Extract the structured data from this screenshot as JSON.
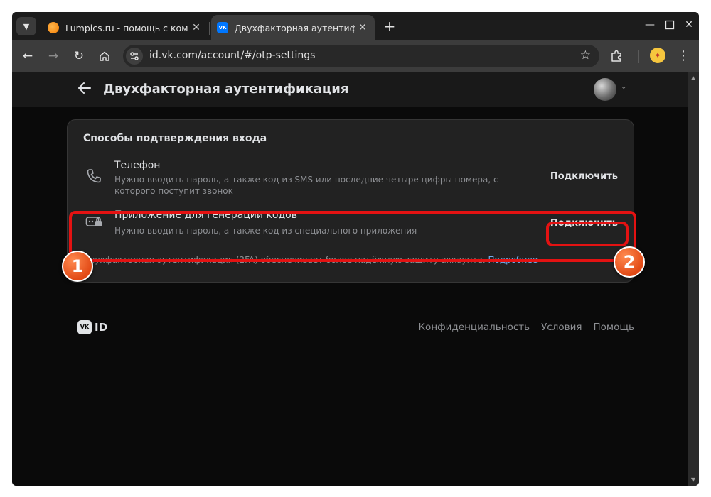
{
  "browser": {
    "tabs": [
      {
        "title": "Lumpics.ru - помощь с компь",
        "favicon": "lumpics-orange-icon",
        "active": false
      },
      {
        "title": "Двухфакторная аутентифика",
        "favicon": "vk-icon",
        "active": true
      }
    ],
    "vk_favicon_text": "VK",
    "url": "id.vk.com/account/#/otp-settings"
  },
  "page": {
    "header_title": "Двухфакторная аутентификация",
    "card": {
      "heading": "Способы подтверждения входа",
      "methods": [
        {
          "title": "Телефон",
          "description": "Нужно вводить пароль, а также код из SMS или последние четыре цифры номера, с которого поступит звонок",
          "button": "Подключить",
          "icon": "phone-icon"
        },
        {
          "title": "Приложение для генерации кодов",
          "description": "Нужно вводить пароль, а также код из специального приложения",
          "button": "Подключить",
          "icon": "code-lock-icon"
        }
      ],
      "footer_text": "Двухфакторная аутентификация (2FA) обеспечивает более надёжную защиту аккаунта.",
      "footer_link": "Подробнее"
    },
    "footer": {
      "logo_vk": "VK",
      "logo_id": "ID",
      "links": [
        "Конфиденциальность",
        "Условия",
        "Помощь"
      ]
    }
  },
  "annotations": {
    "badge_1": "1",
    "badge_2": "2",
    "highlight_color": "#e41212",
    "badge_color": "#e24a16"
  },
  "colors": {
    "accent_link": "#71aaeb",
    "page_bg": "#0a0a0a",
    "card_bg": "#222222"
  }
}
